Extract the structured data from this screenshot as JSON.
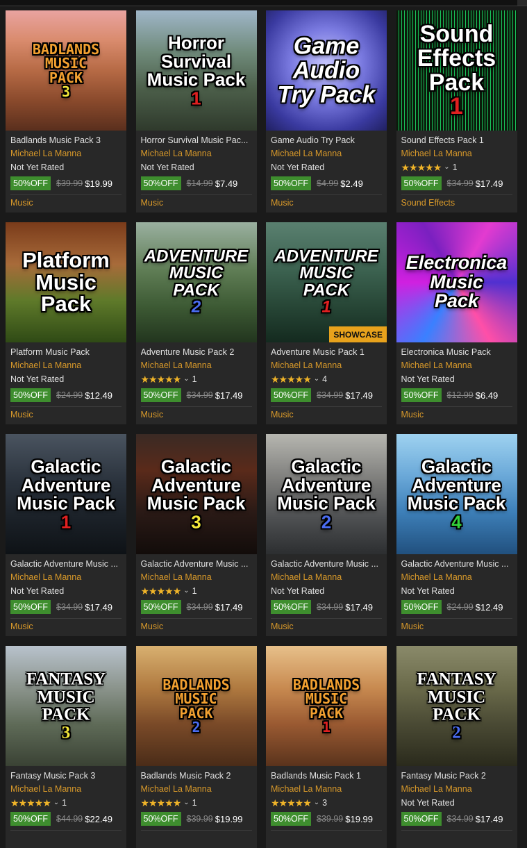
{
  "products": [
    {
      "thumb_title": "BADLANDS\nMUSIC\nPACK",
      "thumb_num": "3",
      "thumb_style": "badlands",
      "num_color": "#f2e73a",
      "name": "Badlands Music Pack 3",
      "author": "Michael La Manna",
      "rating_text": "Not Yet Rated",
      "stars": "",
      "rating_count": "",
      "discount": "50%OFF",
      "old_price": "$39.99",
      "new_price": "$19.99",
      "category": "Music",
      "showcase": ""
    },
    {
      "thumb_title": "Horror\nSurvival\nMusic Pack",
      "thumb_num": "1",
      "thumb_style": "horror",
      "num_color": "#e02020",
      "name": "Horror Survival Music Pac...",
      "author": "Michael La Manna",
      "rating_text": "Not Yet Rated",
      "stars": "",
      "rating_count": "",
      "discount": "50%OFF",
      "old_price": "$14.99",
      "new_price": "$7.49",
      "category": "Music",
      "showcase": ""
    },
    {
      "thumb_title": "Game\nAudio\nTry Pack",
      "thumb_num": "",
      "thumb_style": "gameaudio",
      "num_color": "#fff",
      "name": "Game Audio Try Pack",
      "author": "Michael La Manna",
      "rating_text": "Not Yet Rated",
      "stars": "",
      "rating_count": "",
      "discount": "50%OFF",
      "old_price": "$4.99",
      "new_price": "$2.49",
      "category": "Music",
      "showcase": ""
    },
    {
      "thumb_title": "Sound\nEffects\nPack",
      "thumb_num": "1",
      "thumb_style": "sfx",
      "num_color": "#e02020",
      "name": "Sound Effects Pack 1",
      "author": "Michael La Manna",
      "rating_text": "",
      "stars": "★★★★★",
      "rating_count": "1",
      "discount": "50%OFF",
      "old_price": "$34.99",
      "new_price": "$17.49",
      "category": "Sound Effects",
      "showcase": ""
    },
    {
      "thumb_title": "Platform\nMusic\nPack",
      "thumb_num": "",
      "thumb_style": "platform",
      "num_color": "#fff",
      "name": "Platform Music Pack",
      "author": "Michael La Manna",
      "rating_text": "Not Yet Rated",
      "stars": "",
      "rating_count": "",
      "discount": "50%OFF",
      "old_price": "$24.99",
      "new_price": "$12.49",
      "category": "Music",
      "showcase": ""
    },
    {
      "thumb_title": "ADVENTURE\nMUSIC\nPACK",
      "thumb_num": "2",
      "thumb_style": "adventure2",
      "num_color": "#4a6cf0",
      "name": "Adventure Music Pack 2",
      "author": "Michael La Manna",
      "rating_text": "",
      "stars": "★★★★★",
      "rating_count": "1",
      "discount": "50%OFF",
      "old_price": "$34.99",
      "new_price": "$17.49",
      "category": "Music",
      "showcase": ""
    },
    {
      "thumb_title": "ADVENTURE\nMUSIC\nPACK",
      "thumb_num": "1",
      "thumb_style": "adventure1",
      "num_color": "#e02020",
      "name": "Adventure Music Pack 1",
      "author": "Michael La Manna",
      "rating_text": "",
      "stars": "★★★★★",
      "rating_count": "4",
      "discount": "50%OFF",
      "old_price": "$34.99",
      "new_price": "$17.49",
      "category": "Music",
      "showcase": "SHOWCASE"
    },
    {
      "thumb_title": "Electronica\nMusic\nPack",
      "thumb_num": "",
      "thumb_style": "electronica",
      "num_color": "#fff",
      "name": "Electronica Music Pack",
      "author": "Michael La Manna",
      "rating_text": "Not Yet Rated",
      "stars": "",
      "rating_count": "",
      "discount": "50%OFF",
      "old_price": "$12.99",
      "new_price": "$6.49",
      "category": "Music",
      "showcase": ""
    },
    {
      "thumb_title": "Galactic\nAdventure\nMusic Pack",
      "thumb_num": "1",
      "thumb_style": "galactic1",
      "num_color": "#e02020",
      "name": "Galactic Adventure Music ...",
      "author": "Michael La Manna",
      "rating_text": "Not Yet Rated",
      "stars": "",
      "rating_count": "",
      "discount": "50%OFF",
      "old_price": "$34.99",
      "new_price": "$17.49",
      "category": "Music",
      "showcase": ""
    },
    {
      "thumb_title": "Galactic\nAdventure\nMusic Pack",
      "thumb_num": "3",
      "thumb_style": "galactic3",
      "num_color": "#f2e73a",
      "name": "Galactic Adventure Music ...",
      "author": "Michael La Manna",
      "rating_text": "",
      "stars": "★★★★★",
      "rating_count": "1",
      "discount": "50%OFF",
      "old_price": "$34.99",
      "new_price": "$17.49",
      "category": "Music",
      "showcase": ""
    },
    {
      "thumb_title": "Galactic\nAdventure\nMusic Pack",
      "thumb_num": "2",
      "thumb_style": "galactic2",
      "num_color": "#4a6cf0",
      "name": "Galactic Adventure Music ...",
      "author": "Michael La Manna",
      "rating_text": "Not Yet Rated",
      "stars": "",
      "rating_count": "",
      "discount": "50%OFF",
      "old_price": "$34.99",
      "new_price": "$17.49",
      "category": "Music",
      "showcase": ""
    },
    {
      "thumb_title": "Galactic\nAdventure\nMusic Pack",
      "thumb_num": "4",
      "thumb_style": "galactic4",
      "num_color": "#33d13a",
      "name": "Galactic Adventure Music ...",
      "author": "Michael La Manna",
      "rating_text": "Not Yet Rated",
      "stars": "",
      "rating_count": "",
      "discount": "50%OFF",
      "old_price": "$24.99",
      "new_price": "$12.49",
      "category": "Music",
      "showcase": ""
    },
    {
      "thumb_title": "FANTASY\nMUSIC\nPACK",
      "thumb_num": "3",
      "thumb_style": "fantasy3",
      "num_color": "#f2e73a",
      "name": "Fantasy Music Pack 3",
      "author": "Michael La Manna",
      "rating_text": "",
      "stars": "★★★★★",
      "rating_count": "1",
      "discount": "50%OFF",
      "old_price": "$44.99",
      "new_price": "$22.49",
      "category": "",
      "showcase": ""
    },
    {
      "thumb_title": "BADLANDS\nMUSIC\nPACK",
      "thumb_num": "2",
      "thumb_style": "badlands2",
      "num_color": "#4a6cf0",
      "name": "Badlands Music Pack 2",
      "author": "Michael La Manna",
      "rating_text": "",
      "stars": "★★★★★",
      "rating_count": "1",
      "discount": "50%OFF",
      "old_price": "$39.99",
      "new_price": "$19.99",
      "category": "",
      "showcase": ""
    },
    {
      "thumb_title": "BADLANDS\nMUSIC\nPACK",
      "thumb_num": "1",
      "thumb_style": "badlands1",
      "num_color": "#e02020",
      "name": "Badlands Music Pack 1",
      "author": "Michael La Manna",
      "rating_text": "",
      "stars": "★★★★★",
      "rating_count": "3",
      "discount": "50%OFF",
      "old_price": "$39.99",
      "new_price": "$19.99",
      "category": "",
      "showcase": ""
    },
    {
      "thumb_title": "FANTASY\nMUSIC\nPACK",
      "thumb_num": "2",
      "thumb_style": "fantasy2",
      "num_color": "#4a6cf0",
      "name": "Fantasy Music Pack 2",
      "author": "Michael La Manna",
      "rating_text": "Not Yet Rated",
      "stars": "",
      "rating_count": "",
      "discount": "50%OFF",
      "old_price": "$34.99",
      "new_price": "$17.49",
      "category": "",
      "showcase": ""
    }
  ],
  "icons": {
    "chevron": "chevron-down-icon",
    "star": "star-icon"
  }
}
